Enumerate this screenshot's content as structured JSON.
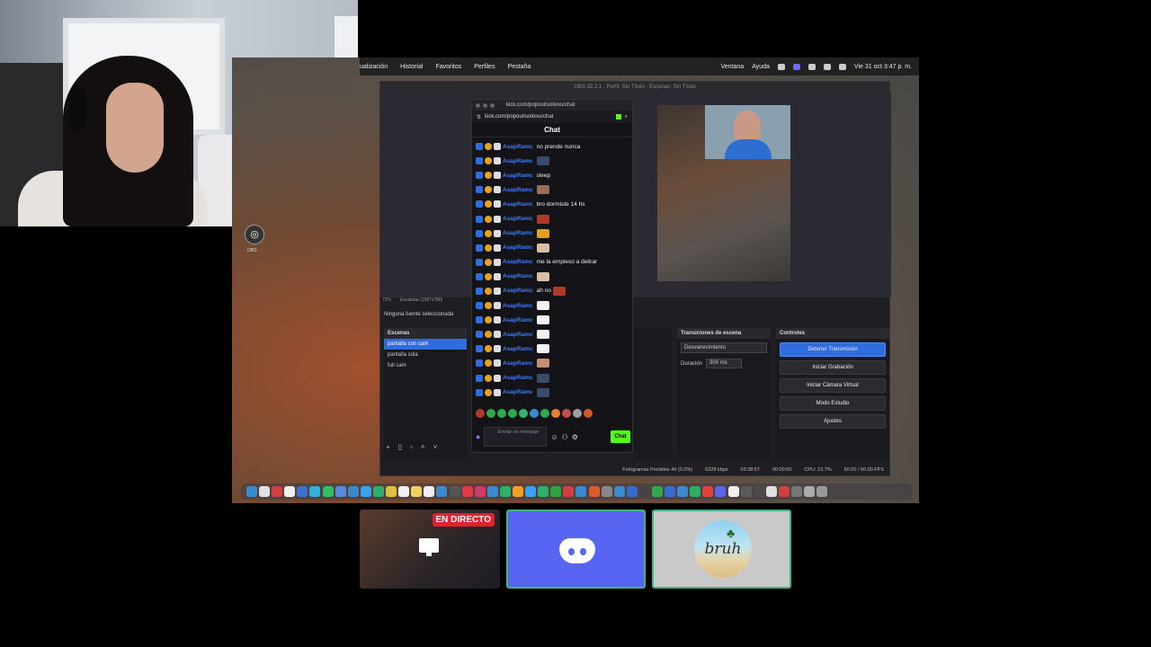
{
  "menubar": {
    "left_items": [
      "ualización",
      "Historial",
      "Favoritos",
      "Perfiles",
      "Pestaña"
    ],
    "right_items": [
      "Ventana",
      "Ayuda"
    ],
    "clock": "Vie 31 oct 3:47 p. m."
  },
  "desktop": {
    "obs_icon_label": "OBS"
  },
  "obs": {
    "title": "OBS 32.2.1 - Perfil: Sin Título - Escenas: Sin Título",
    "scale_label": "72%",
    "resolution_label": "Escalada (1387x780)",
    "no_source": "Ninguna fuente seleccionada",
    "scenes_title": "Escenas",
    "scenes": [
      "pantalla con cam",
      "pantalla sola",
      "full cam"
    ],
    "transitions_title": "Transiciones de escena",
    "transition_value": "Desvanecimiento",
    "duration_label": "Duración",
    "duration_value": "300 ms",
    "controls_title": "Controles",
    "controls": {
      "stop_stream": "Detener Transmisión",
      "start_recording": "Iniciar Grabación",
      "start_virtual_cam": "Iniciar Cámara Virtual",
      "studio_mode": "Modo Estudio",
      "settings": "Ajustes"
    },
    "status": {
      "dropped_frames": "Fotogramas Perdidos 46 (0.0%)",
      "bitrate": "6228 kbps",
      "stream_time": "03:38:57",
      "rec_time": "00:00:00",
      "cpu": "CPU: 13.7%",
      "fps": "60.00 / 60.00 FPS"
    }
  },
  "chat": {
    "window_title": "kick.com/popout/solixxu/chat",
    "url": "kick.com/popout/solixxu/chat",
    "header": "Chat",
    "username": "AsapRamc",
    "messages": [
      {
        "text": "no prende nunca",
        "emote": ""
      },
      {
        "text": "",
        "emote": "#3a4a6a"
      },
      {
        "text": "sleep",
        "emote": ""
      },
      {
        "text": "",
        "emote": "#9a6a5a"
      },
      {
        "text": "bro dormiste 14 hs",
        "emote": ""
      },
      {
        "text": "",
        "emote": "#b03a2a"
      },
      {
        "text": "",
        "emote": "#e0a020"
      },
      {
        "text": "",
        "emote": "#d8c0a8"
      },
      {
        "text": "me la empieso a delirar",
        "emote": ""
      },
      {
        "text": "",
        "emote": "#d8c0a8"
      },
      {
        "text": "ah no",
        "emote": "#b03a2a"
      },
      {
        "text": "",
        "emote": "#f2f2f2"
      },
      {
        "text": "",
        "emote": "#f2f2f2"
      },
      {
        "text": "",
        "emote": "#f2f2f2"
      },
      {
        "text": "",
        "emote": "#f2f2f2"
      },
      {
        "text": "",
        "emote": "#c09070"
      },
      {
        "text": "",
        "emote": "#3a4a6a"
      },
      {
        "text": "",
        "emote": "#3a4a6a"
      }
    ],
    "input_placeholder": "Enviar un mensaje",
    "send_label": "Chat"
  },
  "tiles": {
    "live_badge": "EN DIRECTO",
    "bruh_text": "bruh"
  },
  "colors": {
    "accent_blue": "#2f6ce0",
    "kick_green": "#53fc18",
    "discord": "#5865f2",
    "live_red": "#e0222f",
    "speaking_border": "#43b581"
  }
}
